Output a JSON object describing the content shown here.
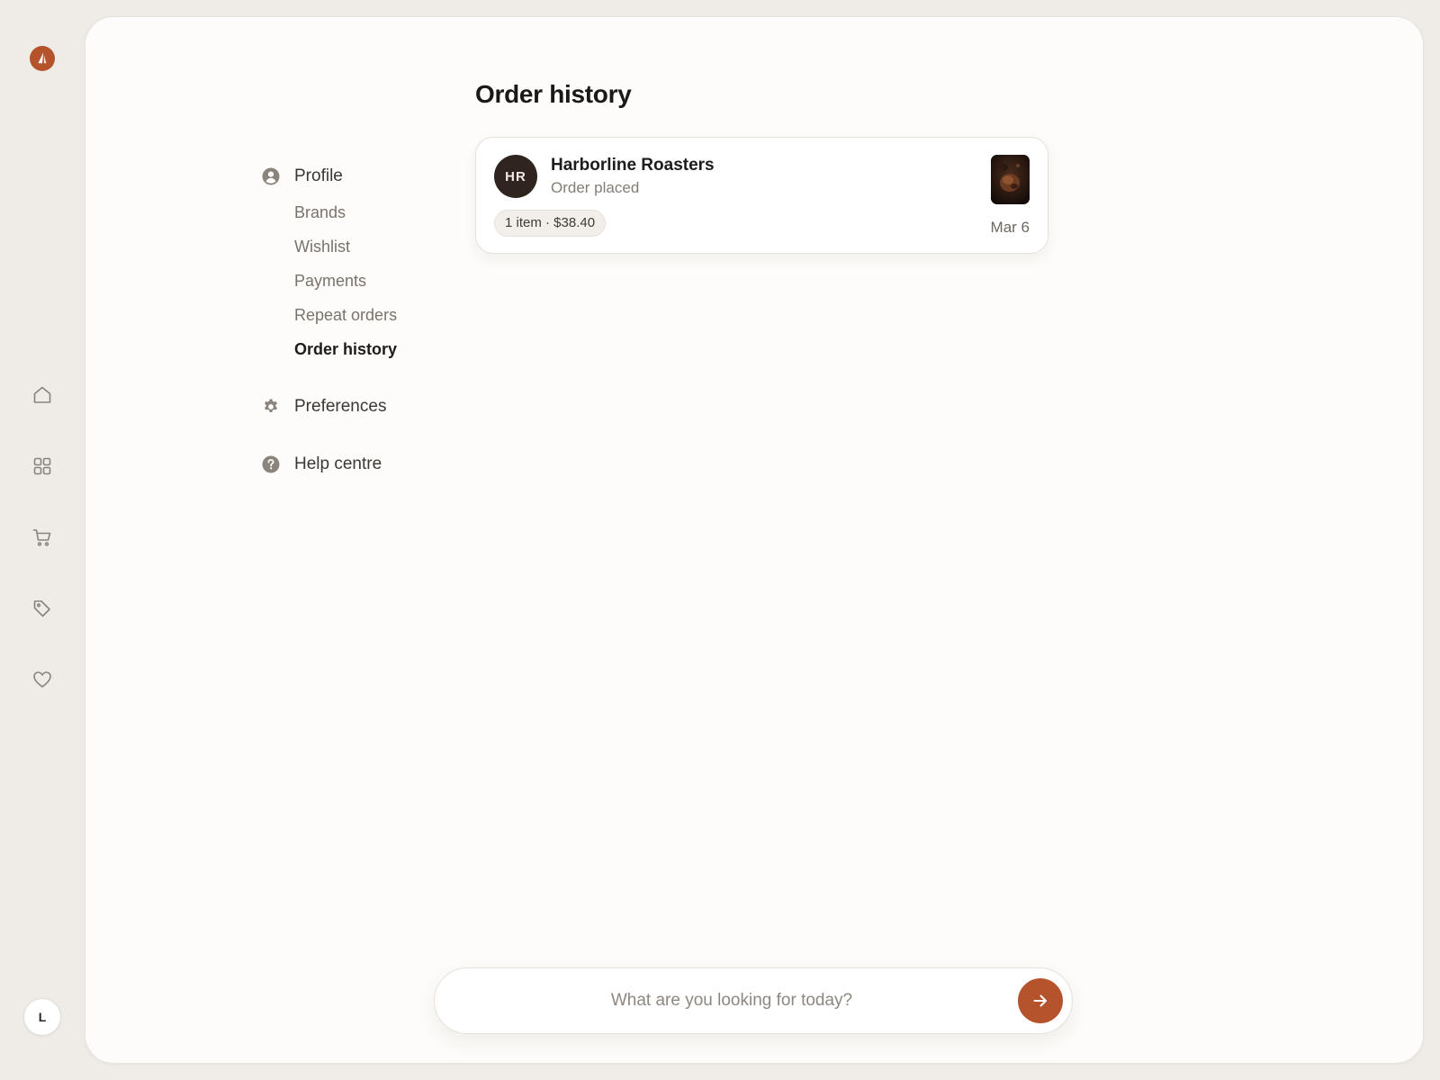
{
  "colors": {
    "accent": "#b5532c"
  },
  "rail": {
    "logo_icon": "brand-logo-icon",
    "items": [
      {
        "name": "home",
        "icon": "home-icon"
      },
      {
        "name": "categories",
        "icon": "grid-icon"
      },
      {
        "name": "cart",
        "icon": "cart-icon"
      },
      {
        "name": "deals",
        "icon": "tag-icon"
      },
      {
        "name": "favorites",
        "icon": "heart-icon"
      }
    ],
    "user_initial": "L"
  },
  "settings_nav": {
    "profile": {
      "label": "Profile",
      "icon": "user-circle-icon",
      "items": [
        "Brands",
        "Wishlist",
        "Payments",
        "Repeat orders",
        "Order history"
      ],
      "active": "Order history"
    },
    "preferences": {
      "label": "Preferences",
      "icon": "gear-icon"
    },
    "help": {
      "label": "Help centre",
      "icon": "question-circle-icon"
    }
  },
  "page": {
    "title": "Order history"
  },
  "orders": [
    {
      "initials": "HR",
      "merchant": "Harborline Roasters",
      "status": "Order placed",
      "summary": "1 item · $38.40",
      "date": "Mar 6",
      "thumbnail": "coffee-product-thumbnail"
    }
  ],
  "search": {
    "placeholder": "What are you looking for today?",
    "value": ""
  }
}
